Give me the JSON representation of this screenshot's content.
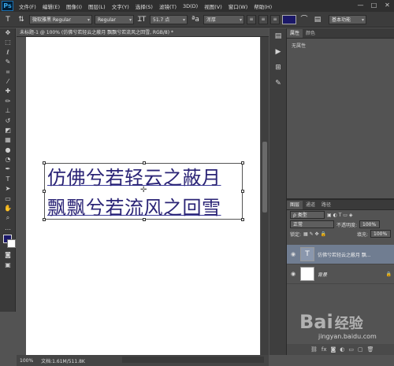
{
  "menu": {
    "logo": "Ps",
    "items": [
      "文件(F)",
      "编辑(E)",
      "图像(I)",
      "图层(L)",
      "文字(Y)",
      "选择(S)",
      "滤镜(T)",
      "3D(D)",
      "视图(V)",
      "窗口(W)",
      "帮助(H)"
    ],
    "win": [
      "—",
      "□",
      "✕"
    ]
  },
  "options": {
    "font_family": "微软雅黑 Regular",
    "font_style": "Regular",
    "font_size": "51.7 点",
    "antialias": "浑厚",
    "color": "#1b1868",
    "workspace": "基本功能"
  },
  "document": {
    "tab_title": "未标题-1 @ 100% (仿佛兮若轻云之蔽月 飘飘兮若流风之回雪, RGB/8) *",
    "lines": [
      "仿佛兮若轻云之蔽月",
      "飘飘兮若流风之回雪"
    ],
    "zoom": "100%",
    "doc_info": "文档:1.61M/511.8K"
  },
  "properties": {
    "tabs": [
      "属性",
      "颜色"
    ],
    "empty_text": "无属性"
  },
  "layers": {
    "tabs": [
      "图层",
      "通道",
      "路径"
    ],
    "filter_label": "ρ 类型",
    "blend_mode": "正常",
    "opacity_label": "不透明度:",
    "opacity": "100%",
    "lock_label": "锁定:",
    "fill_label": "填充:",
    "fill": "100%",
    "items": [
      {
        "name": "仿佛兮若轻云之蔽月 飘...",
        "type": "text",
        "active": true
      },
      {
        "name": "背景",
        "type": "background",
        "active": false
      }
    ]
  },
  "watermark": {
    "logo": "Bai",
    "brand": "经验",
    "url": "jingyan.baidu.com"
  },
  "colors": {
    "text": "#2b2476",
    "accent": "#1b1868"
  }
}
